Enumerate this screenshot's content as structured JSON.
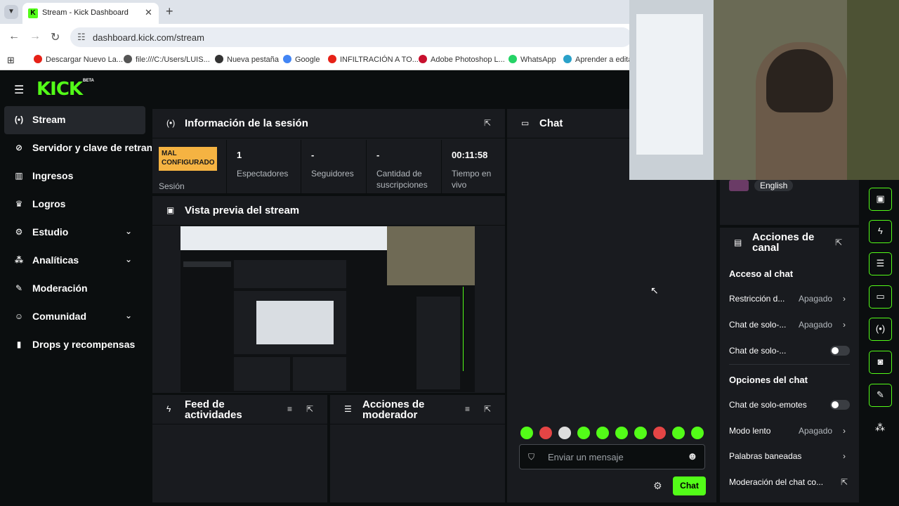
{
  "browser": {
    "tab_title": "Stream - Kick Dashboard",
    "url": "dashboard.kick.com/stream",
    "bookmarks": [
      {
        "label": "Descargar Nuevo La...",
        "color": "#e62117"
      },
      {
        "label": "file:///C:/Users/LUIS...",
        "color": "#555555"
      },
      {
        "label": "Nueva pestaña",
        "color": "#333333"
      },
      {
        "label": "Google",
        "color": "#4285f4"
      },
      {
        "label": "INFILTRACIÓN A TO...",
        "color": "#e62117"
      },
      {
        "label": "Adobe Photoshop L...",
        "color": "#c8102e"
      },
      {
        "label": "WhatsApp",
        "color": "#25d366"
      },
      {
        "label": "Aprender a editar",
        "color": "#2aa1c9"
      }
    ]
  },
  "brand": {
    "logo": "KICK",
    "beta": "BETA",
    "accent": "#53fc18"
  },
  "sidebar": {
    "items": [
      {
        "label": "Stream",
        "icon": "broadcast-icon",
        "glyph": "(•)",
        "active": true
      },
      {
        "label": "Servidor y clave de retransmisión",
        "icon": "link-icon",
        "glyph": "⊘"
      },
      {
        "label": "Ingresos",
        "icon": "chart-icon",
        "glyph": "▥"
      },
      {
        "label": "Logros",
        "icon": "trophy-icon",
        "glyph": "♛"
      },
      {
        "label": "Estudio",
        "icon": "gear-icon",
        "glyph": "⚙",
        "chevron": true
      },
      {
        "label": "Analíticas",
        "icon": "analytics-icon",
        "glyph": "⁂",
        "chevron": true
      },
      {
        "label": "Moderación",
        "icon": "wrench-icon",
        "glyph": "✎"
      },
      {
        "label": "Comunidad",
        "icon": "community-icon",
        "glyph": "☺",
        "chevron": true
      },
      {
        "label": "Drops y recompensas",
        "icon": "drops-icon",
        "glyph": "▮"
      }
    ]
  },
  "session": {
    "title": "Información de la sesión",
    "status_badge": "MAL CONFIGURADO",
    "status_label": "Sesión",
    "stats": [
      {
        "value": "1",
        "label": "Espectadores"
      },
      {
        "value": "-",
        "label": "Seguidores"
      },
      {
        "value": "-",
        "label": "Cantidad de suscripciones"
      },
      {
        "value": "00:11:58",
        "label": "Tiempo en vivo"
      }
    ]
  },
  "preview": {
    "title": "Vista previa del stream"
  },
  "feed": {
    "title": "Feed de actividades"
  },
  "modactions": {
    "title": "Acciones de moderador"
  },
  "chat": {
    "title": "Chat",
    "placeholder": "Enviar un mensaje",
    "send_label": "Chat",
    "emote_colors": [
      "#53fc18",
      "#e54545",
      "#dddddd",
      "#53fc18",
      "#53fc18",
      "#53fc18",
      "#53fc18",
      "#e54545",
      "#53fc18",
      "#53fc18"
    ]
  },
  "language": {
    "label": "English"
  },
  "channel_actions": {
    "title": "Acciones de canal",
    "access_section": "Acceso al chat",
    "options_section": "Opciones del chat",
    "rows_access": [
      {
        "label": "Restricción d...",
        "value": "Apagado",
        "kind": "chevron"
      },
      {
        "label": "Chat de solo-...",
        "value": "Apagado",
        "kind": "chevron"
      },
      {
        "label": "Chat de solo-...",
        "value": "",
        "kind": "toggle"
      }
    ],
    "rows_options": [
      {
        "label": "Chat de solo-emotes",
        "value": "",
        "kind": "toggle"
      },
      {
        "label": "Modo lento",
        "value": "Apagado",
        "kind": "chevron"
      },
      {
        "label": "Palabras baneadas",
        "value": "",
        "kind": "chevron"
      },
      {
        "label": "Moderación del chat co...",
        "value": "",
        "kind": "external"
      }
    ]
  },
  "right_rail": [
    {
      "icon": "preview-icon",
      "glyph": "▣"
    },
    {
      "icon": "lightning-icon",
      "glyph": "ϟ"
    },
    {
      "icon": "list-icon",
      "glyph": "☰"
    },
    {
      "icon": "chat-icon",
      "glyph": "▭"
    },
    {
      "icon": "broadcast-icon",
      "glyph": "(•)"
    },
    {
      "icon": "camera-icon",
      "glyph": "◙"
    },
    {
      "icon": "wrench-icon",
      "glyph": "✎"
    }
  ]
}
